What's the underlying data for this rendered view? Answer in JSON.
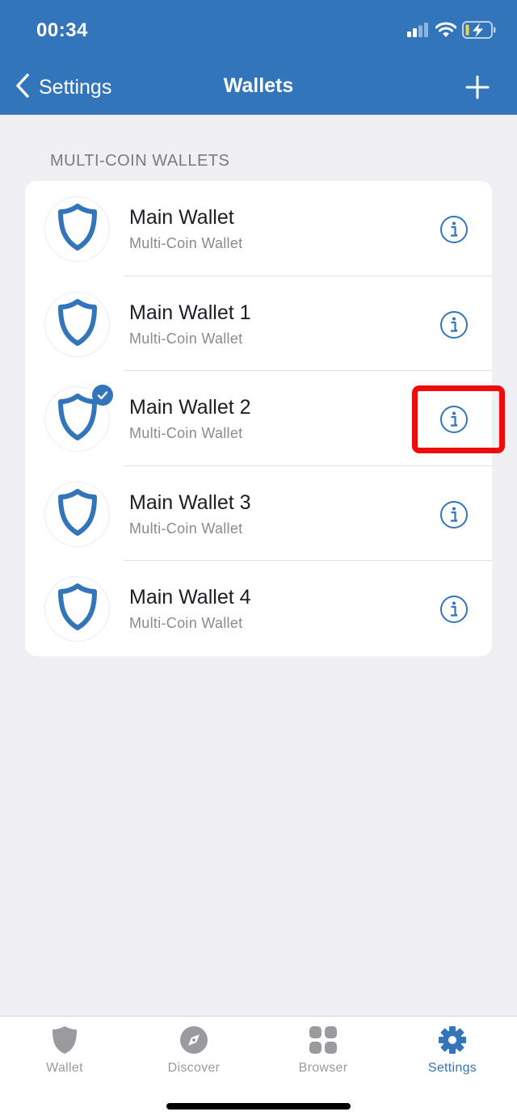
{
  "status_bar": {
    "time": "00:34",
    "signal_icon": "cellular-signal-icon",
    "wifi_icon": "wifi-icon",
    "battery_icon": "battery-charging-icon"
  },
  "nav": {
    "back_label": "Settings",
    "title": "Wallets",
    "add_icon": "plus-icon"
  },
  "section": {
    "header": "MULTI-COIN WALLETS"
  },
  "wallets": [
    {
      "name": "Main Wallet",
      "type": "Multi-Coin Wallet",
      "selected": false
    },
    {
      "name": "Main Wallet 1",
      "type": "Multi-Coin Wallet",
      "selected": false
    },
    {
      "name": "Main Wallet 2",
      "type": "Multi-Coin Wallet",
      "selected": true
    },
    {
      "name": "Main Wallet 3",
      "type": "Multi-Coin Wallet",
      "selected": false
    },
    {
      "name": "Main Wallet 4",
      "type": "Multi-Coin Wallet",
      "selected": false
    }
  ],
  "tabs": [
    {
      "label": "Wallet",
      "icon": "shield-icon",
      "active": false
    },
    {
      "label": "Discover",
      "icon": "compass-icon",
      "active": false
    },
    {
      "label": "Browser",
      "icon": "grid-icon",
      "active": false
    },
    {
      "label": "Settings",
      "icon": "gear-icon",
      "active": true
    }
  ],
  "colors": {
    "brand": "#3375bb",
    "background": "#efeff4",
    "highlight": "#ee0c0c",
    "inactive_tab": "#9a9a9f"
  }
}
